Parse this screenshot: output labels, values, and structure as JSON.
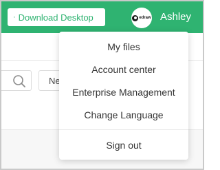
{
  "header": {
    "download_button": {
      "icon": "dot-icon",
      "label": "Download Desktop"
    },
    "avatar": {
      "logo_text": "edraw",
      "icon": "edraw-logo-icon"
    },
    "username": "Ashley",
    "accent_color": "#2fb371"
  },
  "toolbar": {
    "search_icon": "search-icon",
    "new_button_label": "Ne"
  },
  "user_menu": {
    "items": [
      {
        "label": "My files"
      },
      {
        "label": "Account center"
      },
      {
        "label": "Enterprise Management"
      },
      {
        "label": "Change Language"
      }
    ],
    "sign_out_label": "Sign out"
  }
}
